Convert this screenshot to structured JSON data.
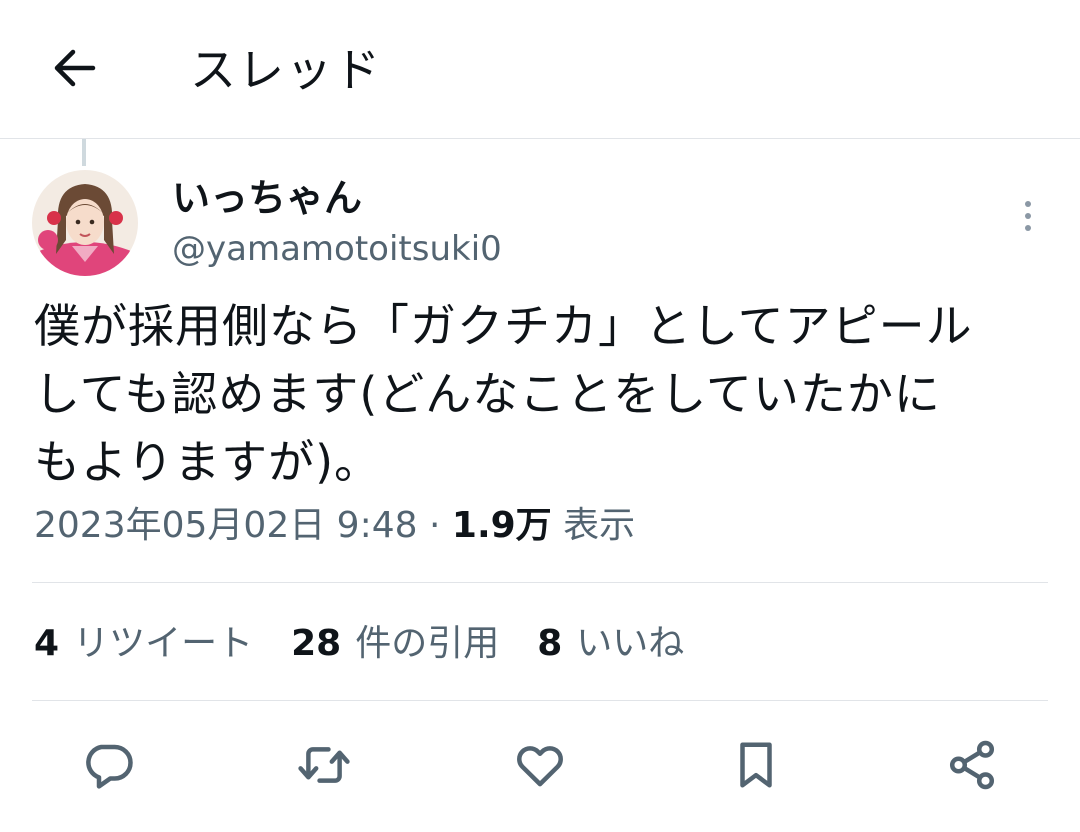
{
  "header": {
    "back_icon": "arrow-left-icon",
    "title": "スレッド"
  },
  "tweet": {
    "author": {
      "name": "いっちゃん",
      "handle": "@yamamotoitsuki0"
    },
    "text_lines": [
      "僕が採用側なら「ガクチカ」としてアピール",
      "しても認めます(どんなことをしていたかに",
      "もよりますが)。"
    ],
    "timestamp": "2023年05月02日 9:48",
    "separator": "·",
    "views_count": "1.9万",
    "views_label": "表示"
  },
  "stats": {
    "retweets_count": "4",
    "retweets_label": "リツイート",
    "quotes_count": "28",
    "quotes_label": "件の引用",
    "likes_count": "8",
    "likes_label": "いいね"
  },
  "actions": [
    "reply-icon",
    "retweet-icon",
    "like-icon",
    "bookmark-icon",
    "share-icon"
  ],
  "colors": {
    "text_primary": "#0f1419",
    "text_secondary": "#536471",
    "divider": "#e1e4e8",
    "icon": "#536471"
  }
}
